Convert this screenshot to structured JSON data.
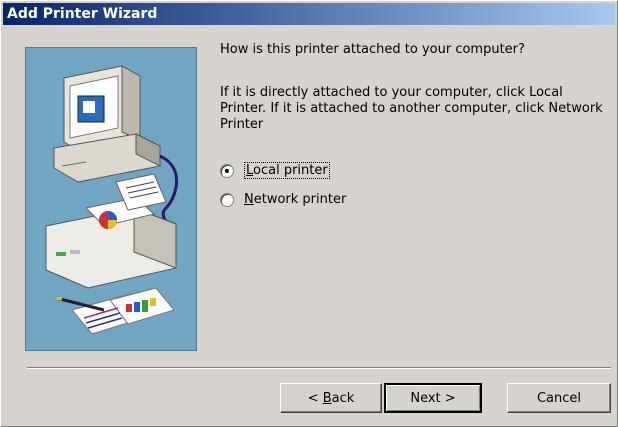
{
  "window": {
    "title": "Add Printer Wizard"
  },
  "content": {
    "question": "How is this printer attached to your computer?",
    "instructions": "If it is directly attached to your computer, click Local Printer. If it is attached to another computer, click Network Printer"
  },
  "options": {
    "local": {
      "mnemonic": "L",
      "rest": "ocal printer",
      "selected": true
    },
    "network": {
      "mnemonic": "N",
      "rest": "etwork printer",
      "selected": false
    }
  },
  "buttons": {
    "back_prefix": "< ",
    "back_mnemonic": "B",
    "back_rest": "ack",
    "next": "Next >",
    "cancel": "Cancel"
  }
}
